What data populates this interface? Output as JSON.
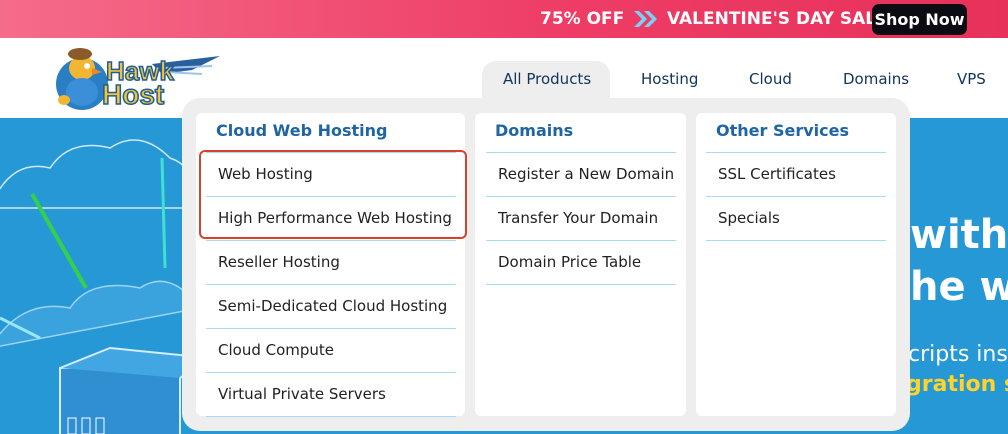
{
  "promo": {
    "discount": "75% OFF",
    "sale_label": "VALENTINE'S DAY SALE",
    "shop_button": "Shop Now",
    "icon": "double-chevron-right-icon"
  },
  "logo": {
    "text_line1": "Hawk",
    "text_line2": "Host"
  },
  "nav": [
    {
      "label": "All Products",
      "active": true
    },
    {
      "label": "Hosting"
    },
    {
      "label": "Cloud"
    },
    {
      "label": "Domains"
    },
    {
      "label": "VPS"
    }
  ],
  "dropdown": {
    "columns": [
      {
        "title": "Cloud Web Hosting",
        "items": [
          "Web Hosting",
          "High Performance Web Hosting",
          "Reseller Hosting",
          "Semi-Dedicated Cloud Hosting",
          "Cloud Compute",
          "Virtual Private Servers"
        ]
      },
      {
        "title": "Domains",
        "items": [
          "Register a New Domain",
          "Transfer Your Domain",
          "Domain Price Table"
        ]
      },
      {
        "title": "Other Services",
        "items": [
          "SSL Certificates",
          "Specials"
        ]
      }
    ]
  },
  "hero": {
    "line1": "with",
    "line2": "he w",
    "line3": "cripts ins",
    "line4": "gration s"
  },
  "colors": {
    "promo": "#ee3d66",
    "hero": "#2798d6",
    "accent": "#1f64a3",
    "highlight": "#d9412f",
    "yellow": "#ffd32a"
  }
}
